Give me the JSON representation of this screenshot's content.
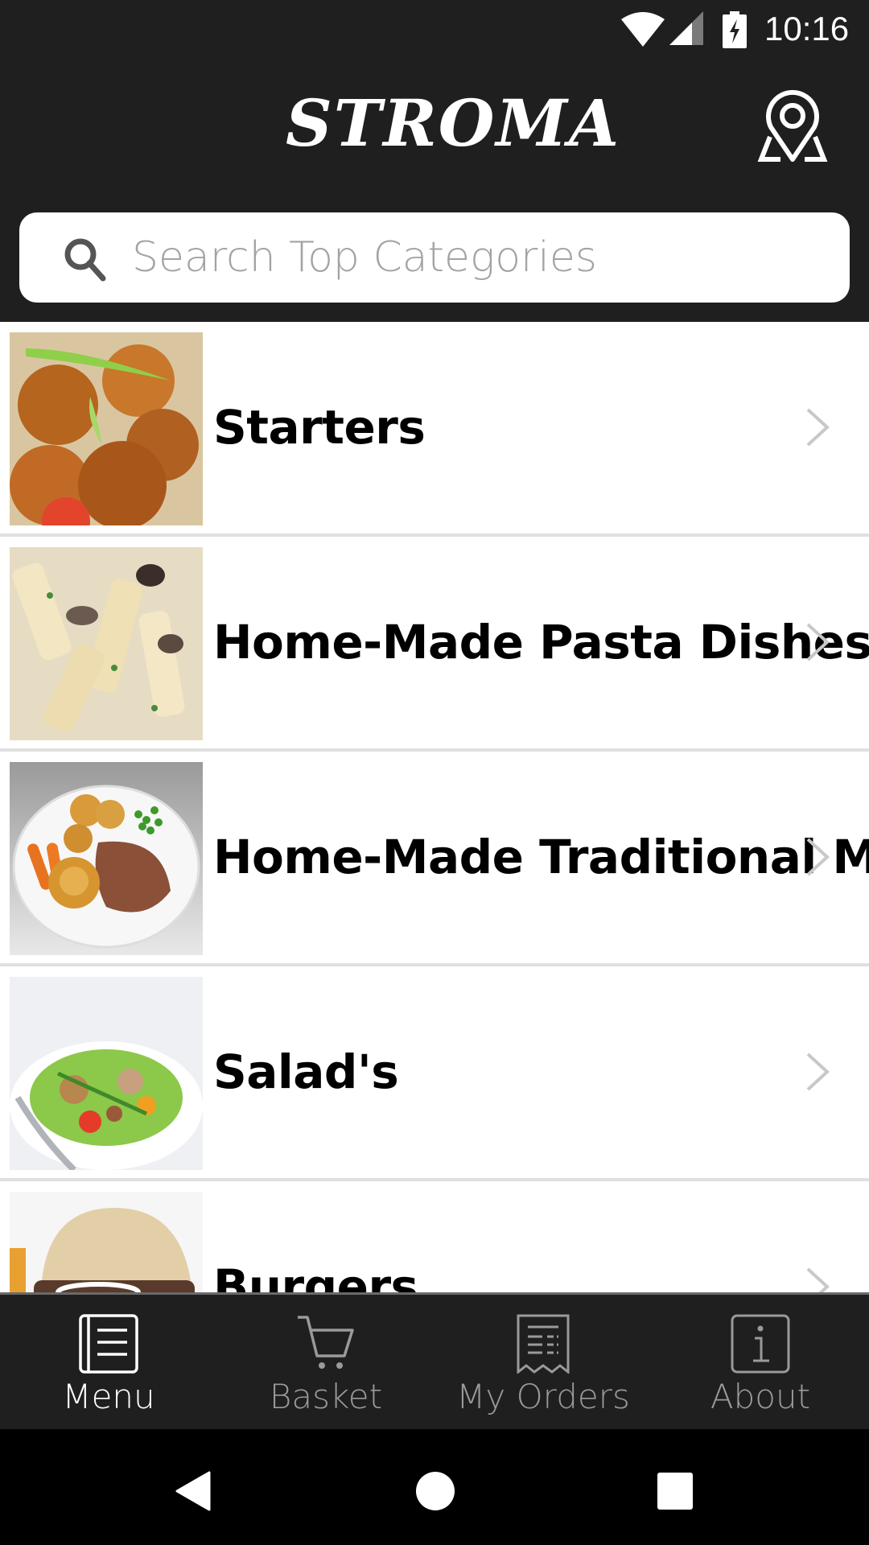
{
  "status_bar": {
    "time": "10:16",
    "icons": [
      "wifi-icon",
      "cell-signal-icon",
      "battery-charging-icon"
    ]
  },
  "header": {
    "logo_text": "STROMA",
    "location_icon": "map-location-pin-icon"
  },
  "search": {
    "placeholder": "Search Top Categories",
    "value": "",
    "icon": "search-icon"
  },
  "categories": [
    {
      "label": "Starters",
      "image": "fried-balls-with-spring-onion"
    },
    {
      "label": "Home-Made Pasta Dishes",
      "image": "penne-mushroom-cream"
    },
    {
      "label": "Home-Made Traditional Meals",
      "image": "roast-dinner-plate"
    },
    {
      "label": "Salad's",
      "image": "chicken-salad-bowl"
    },
    {
      "label": "Burgers",
      "image": "burger-bun-tomato"
    }
  ],
  "bottom_nav": {
    "items": [
      {
        "label": "Menu",
        "icon": "menu-book-icon",
        "active": true
      },
      {
        "label": "Basket",
        "icon": "cart-icon",
        "active": false
      },
      {
        "label": "My Orders",
        "icon": "receipt-icon",
        "active": false
      },
      {
        "label": "About",
        "icon": "info-icon",
        "active": false
      }
    ]
  },
  "system_nav": [
    "back",
    "home",
    "recents"
  ],
  "colors": {
    "header_bg": "#1f1f1f",
    "nav_active": "#ffffff",
    "nav_inactive": "#9a9a9a",
    "placeholder": "#a3a3a3",
    "divider": "#e0e0e0",
    "chevron": "#c8c8c8"
  }
}
